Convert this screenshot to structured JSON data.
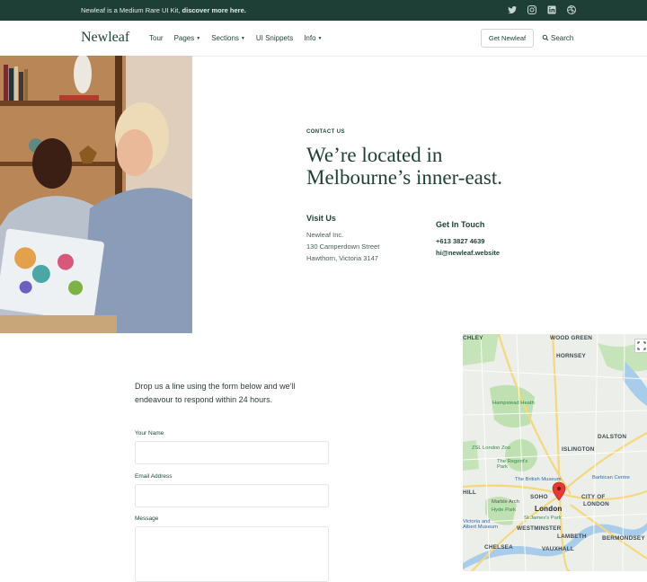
{
  "topbar": {
    "message": "Newleaf is a Medium Rare UI Kit, ",
    "link": "discover more here.",
    "icons": [
      "twitter-icon",
      "instagram-icon",
      "linkedin-icon",
      "dribbble-icon"
    ]
  },
  "nav": {
    "logo": "Newleaf",
    "items": [
      {
        "label": "Tour",
        "dropdown": false
      },
      {
        "label": "Pages",
        "dropdown": true
      },
      {
        "label": "Sections",
        "dropdown": true
      },
      {
        "label": "UI Snippets",
        "dropdown": false
      },
      {
        "label": "Info",
        "dropdown": true
      }
    ],
    "cta": "Get Newleaf",
    "search": "Search"
  },
  "contact": {
    "eyebrow": "CONTACT US",
    "headline_line1": "We’re located in",
    "headline_line2": "Melbourne’s inner-east.",
    "visit_title": "Visit Us",
    "visit_lines": [
      "Newleaf Inc.",
      "130 Camperdown Street",
      "Hawthorn, Victoria 3147"
    ],
    "touch_title": "Get In Touch",
    "phone": "+613 3827 4639",
    "email": "hi@newleaf.website"
  },
  "form": {
    "intro": "Drop us a line using the form below and we’ll endeavour to respond within 24 hours.",
    "name_label": "Your Name",
    "email_label": "Email Address",
    "message_label": "Message"
  },
  "map": {
    "labels": [
      "CHLEY",
      "WOOD GREEN",
      "HORNSEY",
      "DALSTON",
      "ISLINGTON",
      "SOHO",
      "CITY OF",
      "LONDON",
      "London",
      "WESTMINSTER",
      "LAMBETH",
      "VAUXHALL",
      "CHELSEA",
      "BERMONDSEY",
      "HILL"
    ],
    "pois": [
      "Hampstead Heath",
      "ZSL London Zoo",
      "The Regent's Park",
      "The British Museum",
      "Barbican Centre",
      "Marble Arch",
      "Hyde Park",
      "St James's Park",
      "Victoria and Albert Museum"
    ]
  },
  "colors": {
    "brand": "#1e3f35",
    "pin": "#e53935"
  }
}
